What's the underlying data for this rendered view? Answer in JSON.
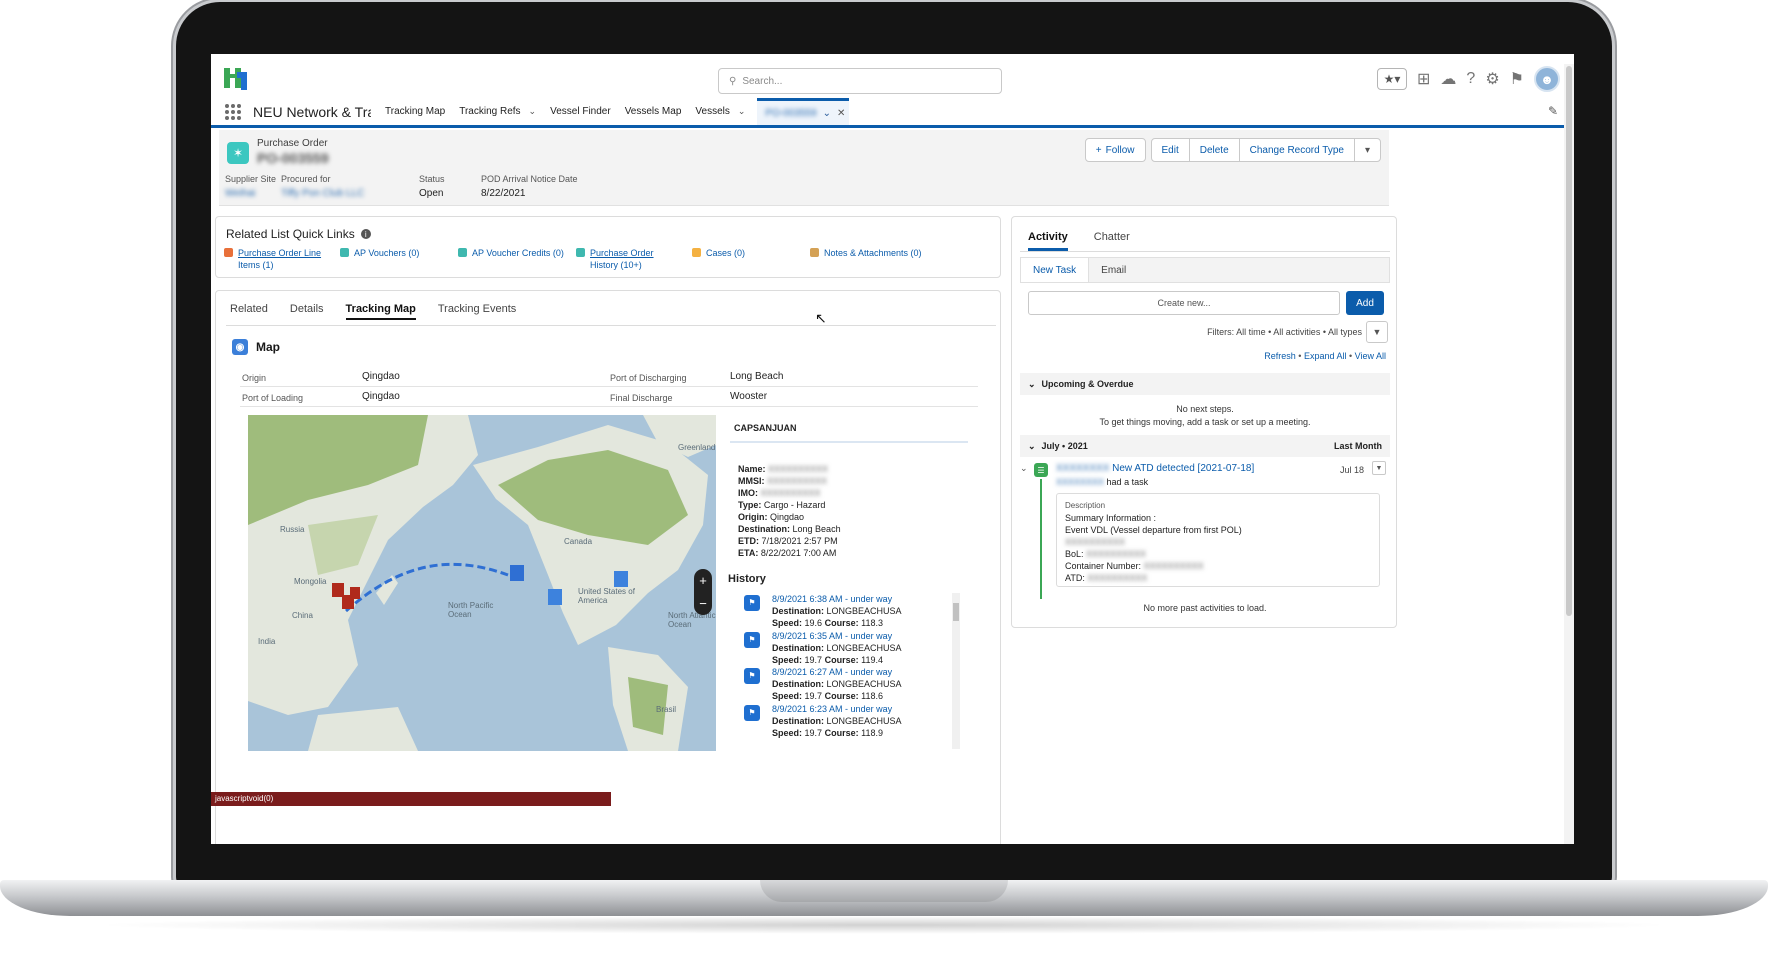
{
  "header": {
    "search_placeholder": "Search...",
    "icons": [
      "favorites-star-icon",
      "add-icon",
      "trailhead-icon",
      "help-icon",
      "gear-icon",
      "bell-icon",
      "avatar"
    ]
  },
  "nav": {
    "app_name": "NEU Network & Tra...",
    "items": [
      {
        "label": "Tracking Map",
        "has_menu": false
      },
      {
        "label": "Tracking Refs",
        "has_menu": true
      },
      {
        "label": "Vessel Finder",
        "has_menu": false
      },
      {
        "label": "Vessels Map",
        "has_menu": false
      },
      {
        "label": "Vessels",
        "has_menu": true
      }
    ],
    "active_tab": "PO-003559"
  },
  "record": {
    "type": "Purchase Order",
    "name": "PO-003559",
    "buttons": {
      "follow": "Follow",
      "edit": "Edit",
      "delete": "Delete",
      "change_type": "Change Record Type"
    },
    "highlights": {
      "supplier_site": {
        "label": "Supplier Site",
        "value": "Weihai"
      },
      "procured_for": {
        "label": "Procured for",
        "value": "Tiffy Pon Club LLC"
      },
      "status": {
        "label": "Status",
        "value": "Open"
      },
      "pod_arrival": {
        "label": "POD Arrival Notice Date",
        "value": "8/22/2021"
      }
    }
  },
  "quick_links": {
    "title": "Related List Quick Links",
    "items": [
      {
        "label": "Purchase Order Line",
        "label2": "Items (1)",
        "color": "#e8703a"
      },
      {
        "label": "AP Vouchers (0)",
        "color": "#3fb8af"
      },
      {
        "label": "AP Voucher Credits (0)",
        "color": "#3fb8af"
      },
      {
        "label": "Purchase Order",
        "label2": "History (10+)",
        "color": "#3fb8af"
      },
      {
        "label": "Cases (0)",
        "color": "#f4b142"
      },
      {
        "label": "Notes & Attachments (0)",
        "color": "#d4a155"
      }
    ]
  },
  "tabs": {
    "related": "Related",
    "details": "Details",
    "tracking_map": "Tracking Map",
    "tracking_events": "Tracking Events"
  },
  "map_section": {
    "title": "Map",
    "origin_label": "Origin",
    "origin": "Qingdao",
    "pol_label": "Port of Loading",
    "pol": "Qingdao",
    "pod_label": "Port of Discharging",
    "pod": "Long Beach",
    "final_label": "Final Discharge",
    "final": "Wooster",
    "map_labels": [
      "Greenland",
      "Russia",
      "Mongolia",
      "China",
      "India",
      "Canada",
      "United States of America",
      "North Pacific Ocean",
      "North Atlantic Ocean",
      "Brasil"
    ]
  },
  "vessel": {
    "tab": "CAPSANJUAN",
    "name_label": "Name:",
    "name": "XXXXXXXXXX",
    "mmsi_label": "MMSI:",
    "mmsi": "XXXXXXXXXX",
    "imo_label": "IMO:",
    "imo": "XXXXXXXXXX",
    "type_label": "Type:",
    "type": "Cargo - Hazard",
    "origin_label": "Origin:",
    "origin": "Qingdao",
    "dest_label": "Destination:",
    "dest": "Long Beach",
    "etd_label": "ETD:",
    "etd": "7/18/2021 2:57 PM",
    "eta_label": "ETA:",
    "eta": "8/22/2021 7:00 AM",
    "history_title": "History",
    "history": [
      {
        "time": "8/9/2021 6:38 AM - under way",
        "dest": "LONGBEACHUSA",
        "speed": "19.6",
        "course": "118.3"
      },
      {
        "time": "8/9/2021 6:35 AM - under way",
        "dest": "LONGBEACHUSA",
        "speed": "19.7",
        "course": "119.4"
      },
      {
        "time": "8/9/2021 6:27 AM - under way",
        "dest": "LONGBEACHUSA",
        "speed": "19.7",
        "course": "118.6"
      },
      {
        "time": "8/9/2021 6:23 AM - under way",
        "dest": "LONGBEACHUSA",
        "speed": "19.7",
        "course": "118.9"
      }
    ],
    "dest_field": "Destination:",
    "speed_field": "Speed:",
    "course_field": "Course:"
  },
  "activity": {
    "tab_activity": "Activity",
    "tab_chatter": "Chatter",
    "new_task": "New Task",
    "email": "Email",
    "create_placeholder": "Create new...",
    "add": "Add",
    "filters": "Filters: All time • All activities • All types",
    "refresh": "Refresh",
    "expand_all": "Expand All",
    "view_all": "View All",
    "upcoming": "Upcoming & Overdue",
    "no_steps_1": "No next steps.",
    "no_steps_2": "To get things moving, add a task or set up a meeting.",
    "month": "July • 2021",
    "last_month": "Last Month",
    "task_title": "New ATD detected [2021-07-18]",
    "task_owner": "XXXXXXXX",
    "task_sub": "had a task",
    "task_date": "Jul 18",
    "desc_label": "Description",
    "desc_line1": "Summary Information :",
    "desc_line2": "Event VDL (Vessel departure from first POL)",
    "desc_blur": "XXXXXXXXXX",
    "bol_label": "BoL:",
    "bol": "XXXXXXXXXX",
    "container_label": "Container Number:",
    "container": "XXXXXXXXXX",
    "atd_label": "ATD:",
    "atd": "XXXXXXXXXX",
    "no_more": "No more past activities to load."
  },
  "status_bar": "javascriptvoid(0)",
  "colors": {
    "brand": "#0b5cab",
    "task_green": "#3ba755",
    "record_icon": "#3cc7c0"
  }
}
